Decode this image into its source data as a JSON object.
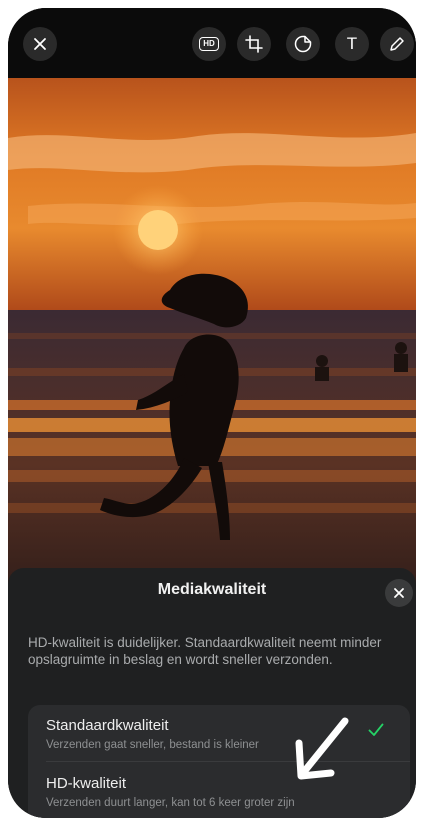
{
  "toolbar": {
    "close_icon": "close-icon",
    "hd_label": "HD",
    "crop_icon": "crop-icon",
    "sticker_icon": "sticker-icon",
    "text_label": "T",
    "draw_icon": "pencil-icon"
  },
  "sheet": {
    "title": "Mediakwaliteit",
    "description": "HD-kwaliteit is duidelijker. Standaardkwaliteit neemt minder opslagruimte in beslag en wordt sneller verzonden.",
    "options": [
      {
        "title": "Standaardkwaliteit",
        "subtitle": "Verzenden gaat sneller, bestand is kleiner",
        "selected": true
      },
      {
        "title": "HD-kwaliteit",
        "subtitle": "Verzenden duurt langer, kan tot 6 keer groter zijn",
        "selected": false
      }
    ]
  },
  "colors": {
    "accent_check": "#25d366",
    "sheet_bg": "#1f2021",
    "option_bg": "#2b2c2e"
  }
}
